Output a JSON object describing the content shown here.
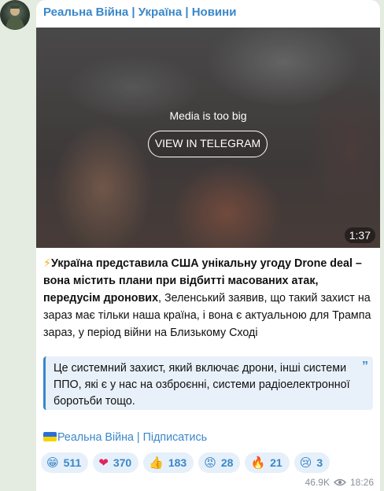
{
  "channel": {
    "title": "Реальна Війна | Україна | Новини"
  },
  "media": {
    "notice": "Media is too big",
    "button_label": "VIEW IN TELEGRAM",
    "duration": "1:37"
  },
  "post": {
    "prefix_icon": "⚡",
    "bold_text": "Україна представила США унікальну угоду Drone deal – вона містить плани при відбитті масованих атак, передусім дронових",
    "regular_text": ", Зеленський заявив, що такий захист на зараз має тільки наша країна, і вона є актуальною для Трампа зараз, у період війни на Близькому Сході",
    "quote": "Це системний захист, який включає дрони, інші системи ППО, які є у нас на озброєнні, системи радіоелектронної боротьби тощо.",
    "quote_icon": "quote-icon"
  },
  "footer": {
    "link_text": "Реальна Війна | Підписатись",
    "flag_icon": "ukraine-flag-icon"
  },
  "reactions": [
    {
      "emoji": "😁",
      "count": "511"
    },
    {
      "emoji": "❤",
      "count": "370"
    },
    {
      "emoji": "👍",
      "count": "183"
    },
    {
      "emoji": "😡",
      "count": "28"
    },
    {
      "emoji": "🔥",
      "count": "21"
    },
    {
      "emoji": "😢",
      "count": "3"
    }
  ],
  "meta": {
    "views": "46.9K",
    "time": "18:26"
  },
  "colors": {
    "accent": "#3a87c8",
    "background": "#e4ebe1",
    "reaction_bg": "#e6f0fa"
  }
}
